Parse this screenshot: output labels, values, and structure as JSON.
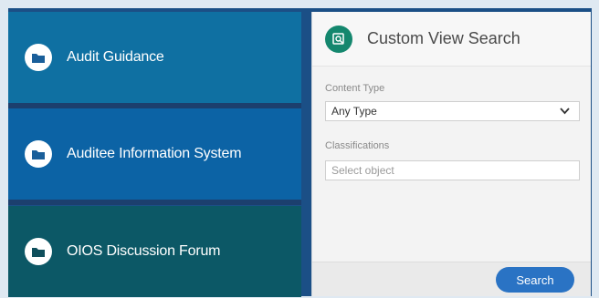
{
  "tiles": [
    {
      "label": "Audit Guidance",
      "icon": "folder-icon"
    },
    {
      "label": "Auditee Information System",
      "icon": "folder-icon"
    },
    {
      "label": "OIOS Discussion Forum",
      "icon": "folder-icon"
    }
  ],
  "panel": {
    "title": "Custom View Search",
    "icon": "search-view-icon",
    "content_type_label": "Content Type",
    "content_type_value": "Any Type",
    "classifications_label": "Classifications",
    "classifications_placeholder": "Select object",
    "search_label": "Search"
  },
  "colors": {
    "tile_1": "#0f70a2",
    "tile_2": "#0c63a5",
    "tile_3": "#0c5866",
    "accent_green": "#14876e",
    "button_blue": "#2a73c4"
  }
}
